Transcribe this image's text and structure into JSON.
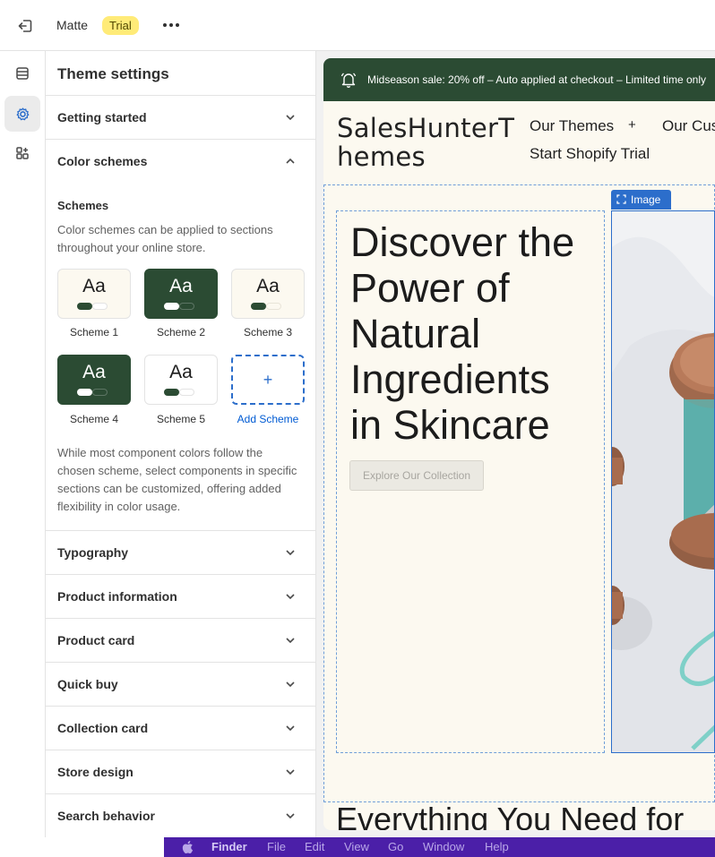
{
  "topbar": {
    "store_name": "Matte",
    "badge": "Trial",
    "exit_icon": "exit-icon",
    "more_icon": "more-horizontal-icon"
  },
  "rail": {
    "items": [
      "sections-icon",
      "theme-settings-icon",
      "apps-icon"
    ],
    "active": 1
  },
  "panel": {
    "title": "Theme settings",
    "sections_top": [
      {
        "label": "Getting started",
        "expanded": false
      },
      {
        "label": "Color schemes",
        "expanded": true
      }
    ],
    "schemes_heading": "Schemes",
    "schemes_desc": "Color schemes can be applied to sections throughout your online store.",
    "swatches": [
      {
        "label": "Scheme 1",
        "text": "Aa",
        "bg": "#fcf9f0",
        "fg": "#1c1c1c",
        "pill1": "#2b4b33",
        "pill2": "#ffffff"
      },
      {
        "label": "Scheme 2",
        "text": "Aa",
        "bg": "#2b4b33",
        "fg": "#ffffff",
        "pill1": "#ffffff",
        "pill2": "#2b4b33"
      },
      {
        "label": "Scheme 3",
        "text": "Aa",
        "bg": "#fcf9f0",
        "fg": "#1c1c1c",
        "pill1": "#2b4b33",
        "pill2": "#fcf9f0"
      },
      {
        "label": "Scheme 4",
        "text": "Aa",
        "bg": "#2b4b33",
        "fg": "#ffffff",
        "pill1": "#ffffff",
        "pill2": "#2b4b33"
      },
      {
        "label": "Scheme 5",
        "text": "Aa",
        "bg": "#ffffff",
        "fg": "#1c1c1c",
        "pill1": "#2b4b33",
        "pill2": "#ffffff"
      }
    ],
    "add_scheme_label": "Add Scheme",
    "add_scheme_symbol": "+",
    "scheme_note": "While most component colors follow the chosen scheme, select components in specific sections can be customized, offering added flexibility in color usage.",
    "sections_bottom": [
      {
        "label": "Typography"
      },
      {
        "label": "Product information"
      },
      {
        "label": "Product card"
      },
      {
        "label": "Quick buy"
      },
      {
        "label": "Collection card"
      },
      {
        "label": "Store design"
      },
      {
        "label": "Search behavior"
      }
    ]
  },
  "preview": {
    "announcement": "Midseason sale: 20% off – Auto applied at checkout – Limited time only",
    "logo": "SalesHunterThemes",
    "nav": [
      "Our Themes",
      "+",
      "Our Customers",
      "Start Shopify Trial"
    ],
    "hero_title": "Discover the Power of Natural Ingredients in Skincare",
    "hero_button": "Explore Our Collection",
    "image_tag": "Image",
    "next_heading": "Everything You Need for"
  },
  "menubar": {
    "items": [
      "Finder",
      "File",
      "Edit",
      "View",
      "Go",
      "Window",
      "Help"
    ],
    "apple_icon": "apple-icon"
  }
}
